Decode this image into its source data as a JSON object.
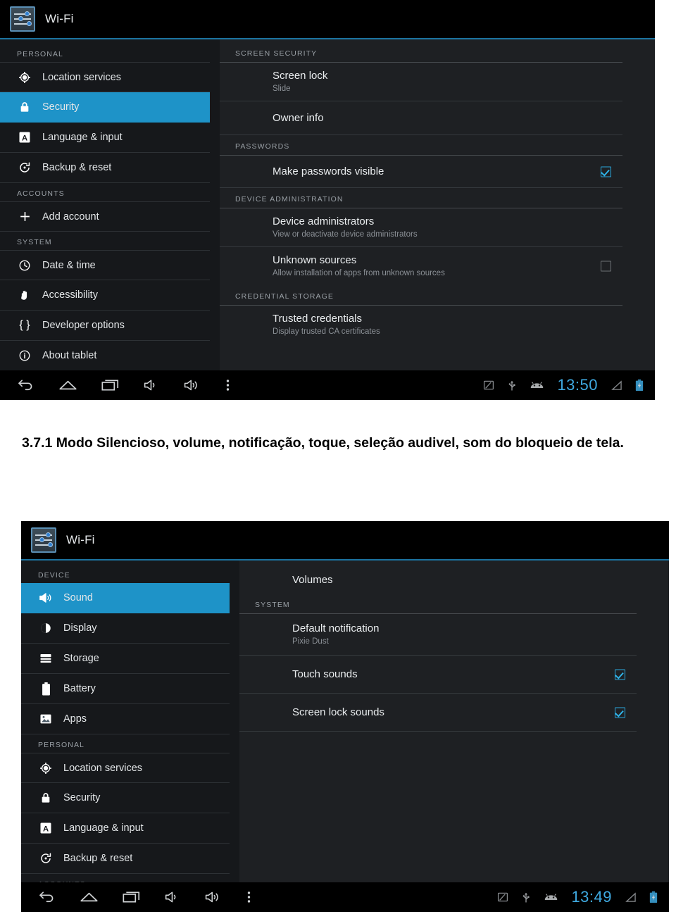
{
  "page": {
    "caption": "3.7.1  Modo Silencioso, volume, notificação, toque, seleção audivel, som do bloqueio de tela."
  },
  "colors": {
    "accent": "#1e93c8",
    "clock": "#3fa9e0",
    "panel_bg": "#1e2023",
    "sidebar_bg": "#16181b",
    "checkbox_on": "#2fb3e8"
  },
  "screenshot_security": {
    "titlebar": {
      "icon": "settings-sliders-icon",
      "title": "Wi-Fi"
    },
    "sidebar": {
      "groups": [
        {
          "header": "PERSONAL",
          "items": [
            {
              "icon": "location-crosshair-icon",
              "label": "Location services",
              "selected": false
            },
            {
              "icon": "lock-icon",
              "label": "Security",
              "selected": true
            },
            {
              "icon": "language-a-icon",
              "label": "Language & input",
              "selected": false
            },
            {
              "icon": "backup-restore-icon",
              "label": "Backup & reset",
              "selected": false
            }
          ]
        },
        {
          "header": "ACCOUNTS",
          "items": [
            {
              "icon": "plus-icon",
              "label": "Add account",
              "selected": false
            }
          ]
        },
        {
          "header": "SYSTEM",
          "items": [
            {
              "icon": "clock-icon",
              "label": "Date & time",
              "selected": false
            },
            {
              "icon": "hand-icon",
              "label": "Accessibility",
              "selected": false
            },
            {
              "icon": "braces-icon",
              "label": "Developer options",
              "selected": false
            },
            {
              "icon": "info-circle-icon",
              "label": "About tablet",
              "selected": false
            }
          ]
        }
      ]
    },
    "content": {
      "sections": [
        {
          "header": "SCREEN SECURITY",
          "items": [
            {
              "title": "Screen lock",
              "subtitle": "Slide",
              "checkbox": null
            },
            {
              "title": "Owner info",
              "subtitle": "",
              "checkbox": null
            }
          ]
        },
        {
          "header": "PASSWORDS",
          "items": [
            {
              "title": "Make passwords visible",
              "subtitle": "",
              "checkbox": "checked"
            }
          ]
        },
        {
          "header": "DEVICE ADMINISTRATION",
          "items": [
            {
              "title": "Device administrators",
              "subtitle": "View or deactivate device administrators",
              "checkbox": null
            },
            {
              "title": "Unknown sources",
              "subtitle": "Allow installation of apps from unknown sources",
              "checkbox": "unchecked"
            }
          ]
        },
        {
          "header": "CREDENTIAL STORAGE",
          "items": [
            {
              "title": "Trusted credentials",
              "subtitle": "Display trusted CA certificates",
              "checkbox": null
            }
          ]
        }
      ]
    },
    "navbar": {
      "buttons": [
        "back-icon",
        "home-icon",
        "recents-icon",
        "volume-down-icon",
        "volume-up-icon",
        "overflow-menu-icon"
      ],
      "status_icons": [
        "screenshot-icon",
        "usb-icon",
        "android-head-icon"
      ],
      "clock": "13:50",
      "trailing_icons": [
        "signal-triangle-icon",
        "battery-charging-icon"
      ]
    }
  },
  "screenshot_sound": {
    "titlebar": {
      "icon": "settings-sliders-icon",
      "title": "Wi-Fi"
    },
    "sidebar": {
      "groups": [
        {
          "header": "DEVICE",
          "items": [
            {
              "icon": "volume-icon",
              "label": "Sound",
              "selected": true
            },
            {
              "icon": "display-contrast-icon",
              "label": "Display",
              "selected": false
            },
            {
              "icon": "storage-icon",
              "label": "Storage",
              "selected": false
            },
            {
              "icon": "battery-icon",
              "label": "Battery",
              "selected": false
            },
            {
              "icon": "apps-image-icon",
              "label": "Apps",
              "selected": false
            }
          ]
        },
        {
          "header": "PERSONAL",
          "items": [
            {
              "icon": "location-crosshair-icon",
              "label": "Location services",
              "selected": false
            },
            {
              "icon": "lock-icon",
              "label": "Security",
              "selected": false
            },
            {
              "icon": "language-a-icon",
              "label": "Language & input",
              "selected": false
            },
            {
              "icon": "backup-restore-icon",
              "label": "Backup & reset",
              "selected": false
            }
          ]
        },
        {
          "header": "ACCOUNTS",
          "items": []
        }
      ]
    },
    "content": {
      "sections": [
        {
          "header": "",
          "items": [
            {
              "title": "Volumes",
              "subtitle": "",
              "checkbox": null
            }
          ]
        },
        {
          "header": "SYSTEM",
          "items": [
            {
              "title": "Default notification",
              "subtitle": "Pixie Dust",
              "checkbox": null
            },
            {
              "title": "Touch sounds",
              "subtitle": "",
              "checkbox": "checked"
            },
            {
              "title": "Screen lock sounds",
              "subtitle": "",
              "checkbox": "checked"
            }
          ]
        }
      ]
    },
    "navbar": {
      "buttons": [
        "back-icon",
        "home-icon",
        "recents-icon",
        "volume-down-icon",
        "volume-up-icon",
        "overflow-menu-icon"
      ],
      "status_icons": [
        "screenshot-icon",
        "usb-icon",
        "android-head-icon"
      ],
      "clock": "13:49",
      "trailing_icons": [
        "signal-triangle-icon",
        "battery-charging-icon"
      ]
    }
  }
}
